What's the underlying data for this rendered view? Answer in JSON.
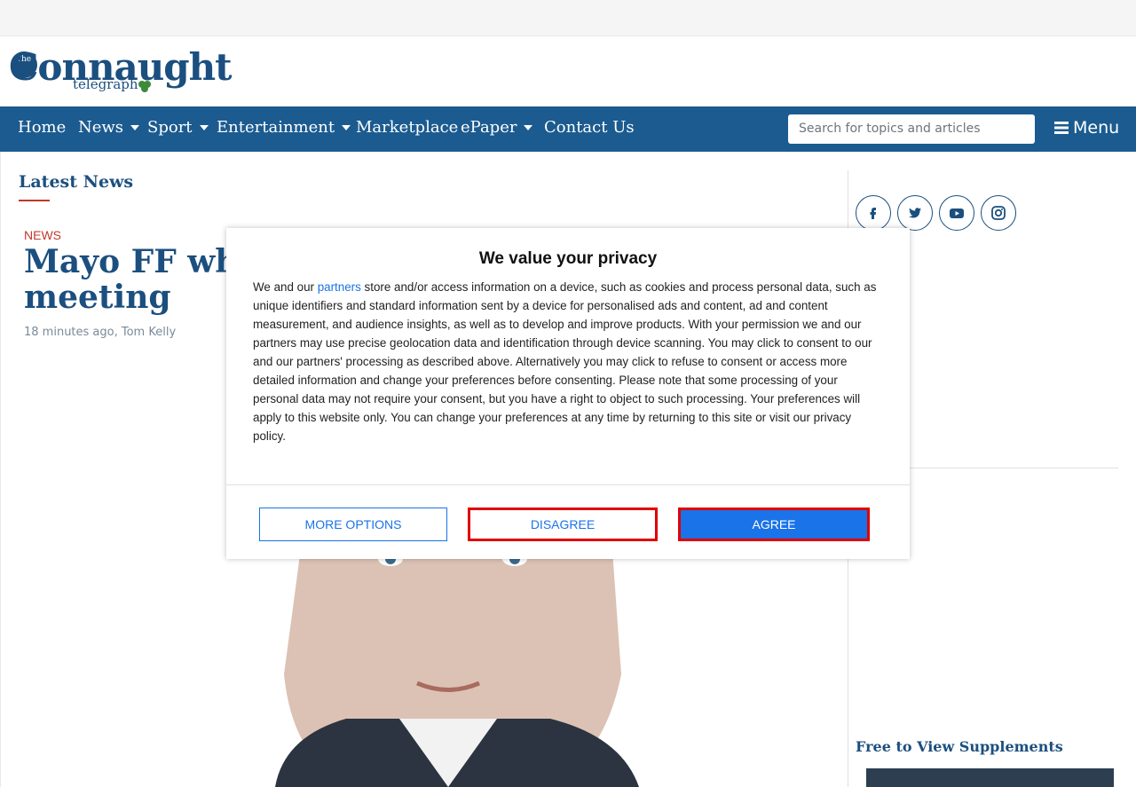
{
  "site": {
    "logo_main": "Connaught",
    "logo_the": "The",
    "logo_sub": "telegraph"
  },
  "nav": {
    "items": [
      {
        "label": "Home",
        "dropdown": false
      },
      {
        "label": "News",
        "dropdown": true
      },
      {
        "label": "Sport",
        "dropdown": true
      },
      {
        "label": "Entertainment",
        "dropdown": true
      },
      {
        "label": "Marketplace",
        "dropdown": false
      },
      {
        "label": "ePaper",
        "dropdown": true
      },
      {
        "label": "Contact Us",
        "dropdown": false
      }
    ],
    "search_placeholder": "Search for topics and articles",
    "menu_label": "Menu"
  },
  "main": {
    "section_title": "Latest News",
    "article": {
      "category": "NEWS",
      "headline_line1": "Mayo FF whip",
      "headline_line2": "meeting",
      "age": "18 minutes ago",
      "author": "Tom Kelly"
    }
  },
  "sidebar": {
    "social": [
      "facebook-icon",
      "twitter-icon",
      "youtube-icon",
      "instagram-icon"
    ],
    "supplements_title": "Free to View Supplements"
  },
  "consent": {
    "title": "We value your privacy",
    "body_before_link": "We and our ",
    "link_text": "partners",
    "body_after_link": " store and/or access information on a device, such as cookies and process personal data, such as unique identifiers and standard information sent by a device for personalised ads and content, ad and content measurement, and audience insights, as well as to develop and improve products. With your permission we and our partners may use precise geolocation data and identification through device scanning. You may click to consent to our and our partners' processing as described above. Alternatively you may click to refuse to consent or access more detailed information and change your preferences before consenting. Please note that some processing of your personal data may not require your consent, but you have a right to object to such processing. Your preferences will apply to this website only. You can change your preferences at any time by returning to this site or visit our privacy policy.",
    "more_options": "MORE OPTIONS",
    "disagree": "DISAGREE",
    "agree": "AGREE"
  },
  "colors": {
    "brand": "#1b5b90",
    "headline": "#1b4f7f",
    "accent_red": "#c0392b",
    "button_blue": "#1a73e8"
  }
}
